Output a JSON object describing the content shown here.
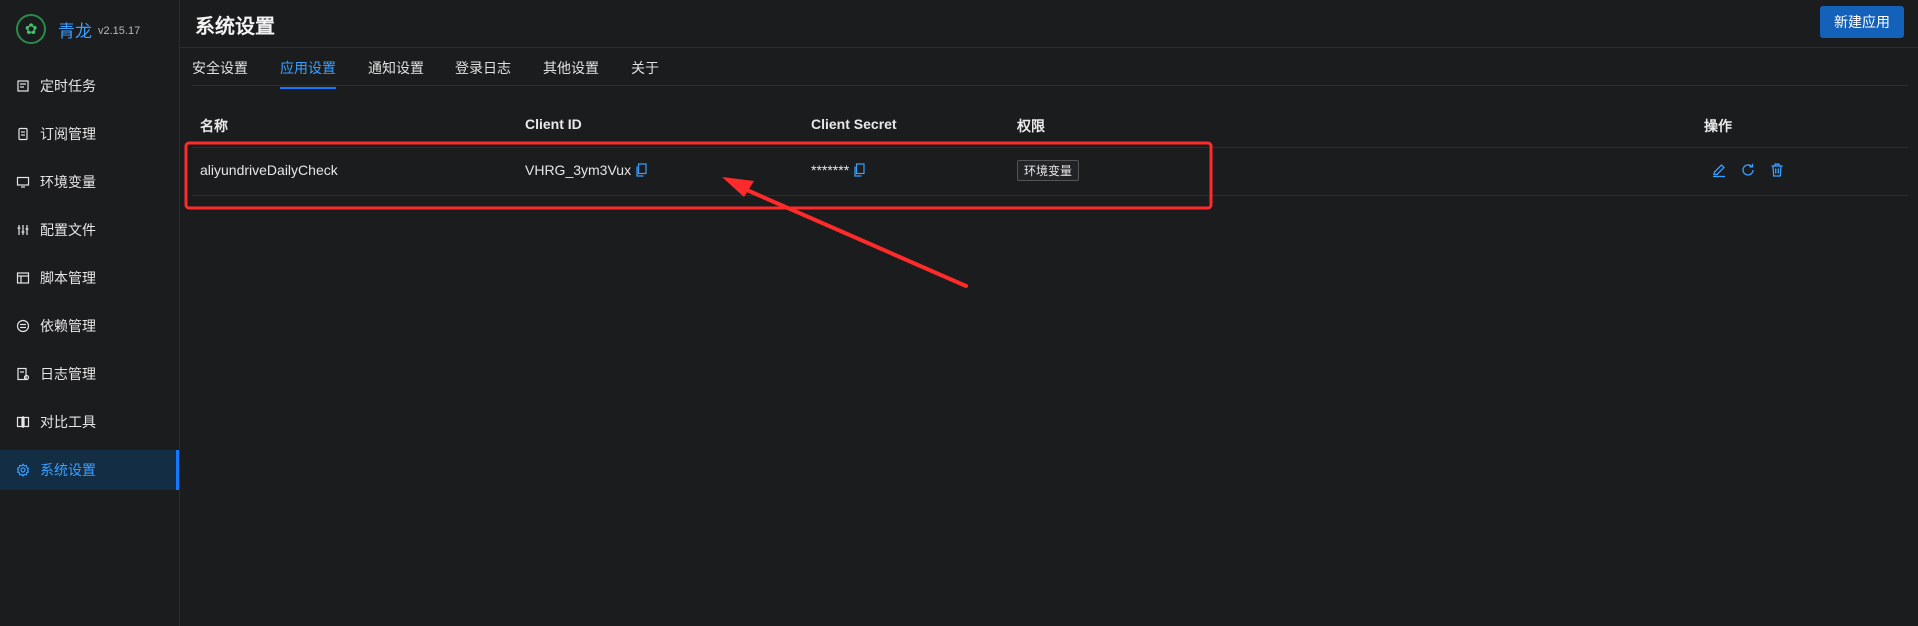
{
  "app": {
    "name": "青龙",
    "version": "v2.15.17",
    "logo_icon": "qinglong-logo-icon"
  },
  "sidebar": {
    "items": [
      {
        "label": "定时任务",
        "icon": "calendar-icon",
        "active": false
      },
      {
        "label": "订阅管理",
        "icon": "subscription-icon",
        "active": false
      },
      {
        "label": "环境变量",
        "icon": "monitor-icon",
        "active": false
      },
      {
        "label": "配置文件",
        "icon": "sliders-icon",
        "active": false
      },
      {
        "label": "脚本管理",
        "icon": "script-icon",
        "active": false
      },
      {
        "label": "依赖管理",
        "icon": "dependency-icon",
        "active": false
      },
      {
        "label": "日志管理",
        "icon": "log-icon",
        "active": false
      },
      {
        "label": "对比工具",
        "icon": "diff-icon",
        "active": false
      },
      {
        "label": "系统设置",
        "icon": "gear-icon",
        "active": true
      }
    ]
  },
  "header": {
    "title": "系统设置",
    "new_button": "新建应用"
  },
  "tabs": [
    {
      "label": "安全设置",
      "active": false
    },
    {
      "label": "应用设置",
      "active": true
    },
    {
      "label": "通知设置",
      "active": false
    },
    {
      "label": "登录日志",
      "active": false
    },
    {
      "label": "其他设置",
      "active": false
    },
    {
      "label": "关于",
      "active": false
    }
  ],
  "table": {
    "columns": {
      "name": "名称",
      "client_id": "Client ID",
      "client_secret": "Client Secret",
      "scope": "权限",
      "actions": "操作"
    },
    "rows": [
      {
        "name": "aliyundriveDailyCheck",
        "client_id": "VHRG_3ym3Vux",
        "client_secret": "*******",
        "scope": "环境变量"
      }
    ]
  },
  "colors": {
    "accent": "#1677ff",
    "link": "#3aa0ff",
    "annotation": "#ff2a2a",
    "background": "#1b1c1e"
  }
}
